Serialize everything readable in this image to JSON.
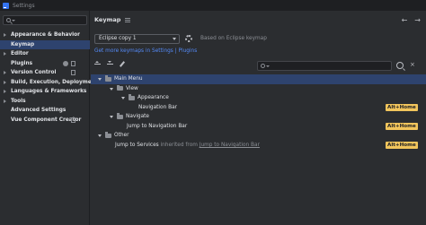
{
  "window": {
    "title": "Settings"
  },
  "sidebar": {
    "search_placeholder": "",
    "items": [
      {
        "label": "Appearance & Behavior",
        "expandable": true
      },
      {
        "label": "Keymap",
        "selected": true
      },
      {
        "label": "Editor",
        "expandable": true
      },
      {
        "label": "Plugins",
        "badges": [
          "info-badge-icon",
          "page-icon"
        ]
      },
      {
        "label": "Version Control",
        "expandable": true,
        "badges": [
          "page-icon"
        ]
      },
      {
        "label": "Build, Execution, Deployment",
        "expandable": true
      },
      {
        "label": "Languages & Frameworks",
        "expandable": true
      },
      {
        "label": "Tools",
        "expandable": true
      },
      {
        "label": "Advanced Settings"
      },
      {
        "label": "Vue Component Creator",
        "badges": [
          "page-icon"
        ]
      }
    ]
  },
  "main": {
    "title": "Keymap",
    "back_icon": "←",
    "forward_icon": "→",
    "keymap_select": {
      "value": "Eclipse copy 1"
    },
    "based_on": "Based on Eclipse keymap",
    "more_link": "Get more keymaps in Settings | Plugins",
    "filter_placeholder": "",
    "clear_icon": "×",
    "tree": [
      {
        "label": "Main Menu",
        "level": 0,
        "folder": true,
        "expanded": true,
        "selected": true
      },
      {
        "label": "View",
        "level": 1,
        "folder": true,
        "expanded": true
      },
      {
        "label": "Appearance",
        "level": 2,
        "folder": true,
        "expanded": true
      },
      {
        "label": "Navigation Bar",
        "level": 3,
        "shortcut": "Alt+Home"
      },
      {
        "label": "Navigate",
        "level": 1,
        "folder": true,
        "expanded": true
      },
      {
        "label": "Jump to Navigation Bar",
        "level": 2,
        "shortcut": "Alt+Home"
      },
      {
        "label": "Other",
        "level": 0,
        "folder": true,
        "expanded": true
      },
      {
        "label": "Jump to Services",
        "level": 1,
        "note": "inherited from",
        "link": "Jump to Navigation Bar",
        "shortcut": "Alt+Home"
      }
    ]
  },
  "colors": {
    "selection": "#2e436e",
    "shortcut_bg": "#f2c55c",
    "link": "#548af7"
  }
}
